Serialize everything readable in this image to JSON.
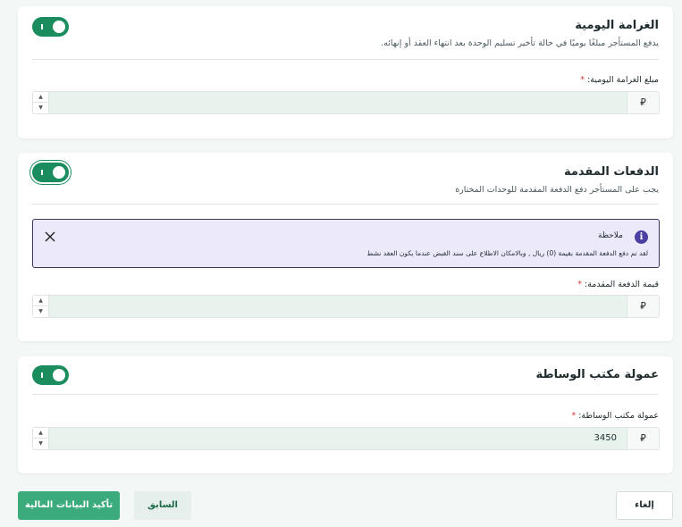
{
  "sections": {
    "daily_penalty": {
      "title": "الغرامة اليومية",
      "description": "يدفع المستأجر مبلغًا يوميًا في حالة تأخير تسليم الوحدة بعد انتهاء العقد أو إنهائه.",
      "toggle_on": true,
      "field_label": "مبلغ الغرامة اليومية:",
      "required_mark": "*",
      "value": "",
      "currency_symbol": "⃁"
    },
    "advance_payments": {
      "title": "الدفعات المقدمة",
      "description": "يجب على المستأجر دفع الدفعة المقدمة للوحدات المختارة",
      "toggle_on": true,
      "note": {
        "title": "ملاحظة",
        "text": "لقد تم دفع الدفعة المقدمة بقيمة (0) ريال , وبالامكان الاطلاع على سند القبض عندما يكون العقد نشط"
      },
      "field_label": "قيمة الدفعة المقدمة:",
      "required_mark": "*",
      "value": "",
      "currency_symbol": "⃁"
    },
    "brokerage_commission": {
      "title": "عمولة مكتب الوساطة",
      "toggle_on": true,
      "field_label": "عمولة مكتب الوساطة:",
      "required_mark": "*",
      "value": "3450",
      "currency_symbol": "⃁"
    }
  },
  "stepper": {
    "up": "▲",
    "down": "▼"
  },
  "icons": {
    "info": "i",
    "toggle": "I"
  },
  "buttons": {
    "confirm": "تأكيد البيانات المالية",
    "previous": "السابق",
    "cancel": "إلغاء"
  },
  "colors": {
    "accent": "#1a8c5e",
    "confirm_button": "#3cab7c",
    "input_fill": "#e8f3ee",
    "note_background": "#ece9fb",
    "note_border": "#3d3560",
    "required": "#d93a3a"
  }
}
